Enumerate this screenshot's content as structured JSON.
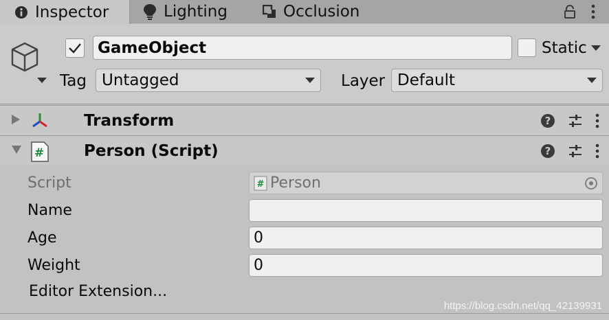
{
  "tabs": [
    {
      "label": "Inspector",
      "icon": "info-icon",
      "active": true
    },
    {
      "label": "Lighting",
      "icon": "lightbulb-icon",
      "active": false
    },
    {
      "label": "Occlusion",
      "icon": "occlusion-icon",
      "active": false
    }
  ],
  "header": {
    "object_name": "GameObject",
    "active_checked": true,
    "static_label": "Static",
    "static_checked": false,
    "tag_label": "Tag",
    "tag_value": "Untagged",
    "layer_label": "Layer",
    "layer_value": "Default"
  },
  "components": [
    {
      "title": "Transform",
      "expanded": false,
      "icon": "transform-icon"
    },
    {
      "title": "Person (Script)",
      "expanded": true,
      "icon": "script-icon"
    }
  ],
  "properties": {
    "script_label": "Script",
    "script_value": "Person",
    "name_label": "Name",
    "name_value": "",
    "age_label": "Age",
    "age_value": "0",
    "weight_label": "Weight",
    "weight_value": "0"
  },
  "editor_extension_label": "Editor Extension...",
  "watermark": "https://blog.csdn.net/qq_42139931",
  "colors": {
    "panel_bg": "#c2c2c2",
    "tabbar_bg": "#a5a5a5",
    "field_bg": "#f0f0f0",
    "script_hash_green": "#1f8a3a"
  }
}
